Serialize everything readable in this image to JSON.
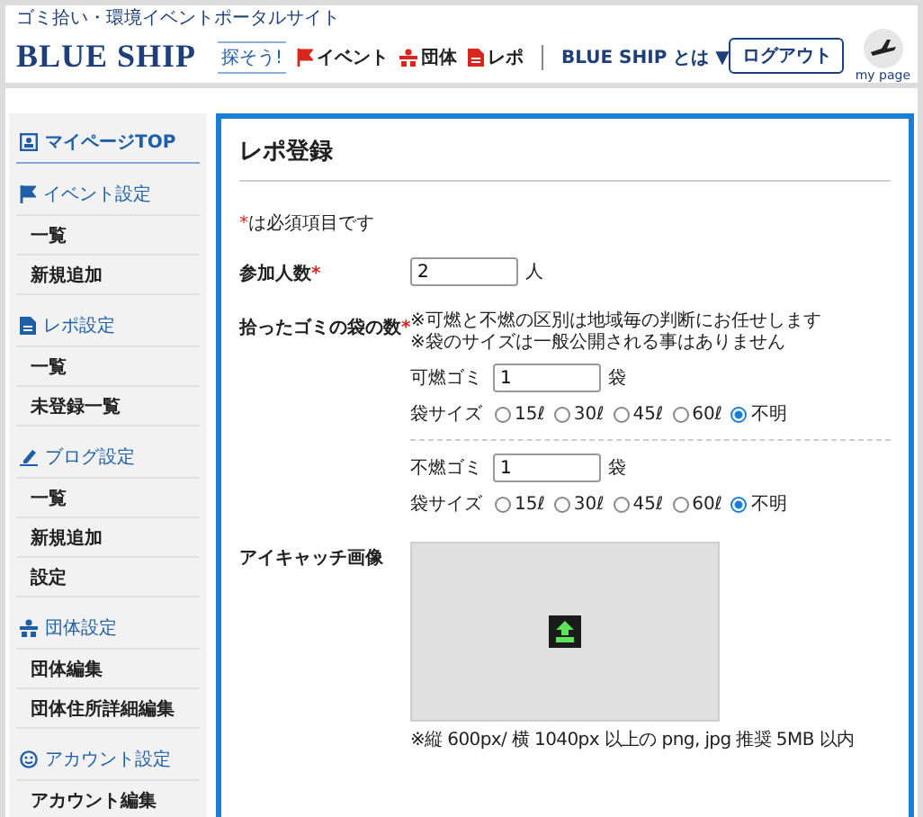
{
  "header": {
    "tagline": "ゴミ拾い・環境イベントポータルサイト",
    "logo": "BLUE SHIP",
    "search_label": "探そう!",
    "nav": [
      {
        "label": "イベント"
      },
      {
        "label": "団体"
      },
      {
        "label": "レポ"
      }
    ],
    "about": "BLUE SHIP とは",
    "about_caret": "▼",
    "logout": "ログアウト",
    "mypage": "my page"
  },
  "sidebar": {
    "sections": [
      {
        "title": "マイページTOP",
        "selected": true
      },
      {
        "title": "イベント設定",
        "selected": false,
        "items": [
          "一覧",
          "新規追加"
        ]
      },
      {
        "title": "レポ設定",
        "selected": false,
        "items": [
          "一覧",
          "未登録一覧"
        ]
      },
      {
        "title": "ブログ設定",
        "selected": false,
        "items": [
          "一覧",
          "新規追加",
          "設定"
        ]
      },
      {
        "title": "団体設定",
        "selected": false,
        "items": [
          "団体編集",
          "団体住所詳細編集"
        ]
      },
      {
        "title": "アカウント設定",
        "selected": false,
        "items": [
          "アカウント編集"
        ]
      }
    ]
  },
  "main": {
    "title": "レポ登録",
    "required_mark": "*",
    "required_note": "は必須項目です",
    "participants": {
      "label": "参加人数",
      "required": true,
      "value": "2",
      "unit": "人"
    },
    "bags": {
      "label": "拾ったゴミの袋の数",
      "required": true,
      "notes": [
        "※可燃と不燃の区別は地域毎の判断にお任せします",
        "※袋のサイズは一般公開される事はありません"
      ],
      "groups": [
        {
          "label": "可燃ゴミ",
          "value": "1",
          "unit": "袋",
          "size_label": "袋サイズ",
          "sizes": [
            {
              "label": "15ℓ",
              "selected": false
            },
            {
              "label": "30ℓ",
              "selected": false
            },
            {
              "label": "45ℓ",
              "selected": false
            },
            {
              "label": "60ℓ",
              "selected": false
            },
            {
              "label": "不明",
              "selected": true
            }
          ]
        },
        {
          "label": "不燃ゴミ",
          "value": "1",
          "unit": "袋",
          "size_label": "袋サイズ",
          "sizes": [
            {
              "label": "15ℓ",
              "selected": false
            },
            {
              "label": "30ℓ",
              "selected": false
            },
            {
              "label": "45ℓ",
              "selected": false
            },
            {
              "label": "60ℓ",
              "selected": false
            },
            {
              "label": "不明",
              "selected": true
            }
          ]
        }
      ]
    },
    "image": {
      "label": "アイキャッチ画像",
      "caption": "※縦 600px/ 横 1040px 以上の png, jpg 推奨 5MB 以内"
    }
  }
}
